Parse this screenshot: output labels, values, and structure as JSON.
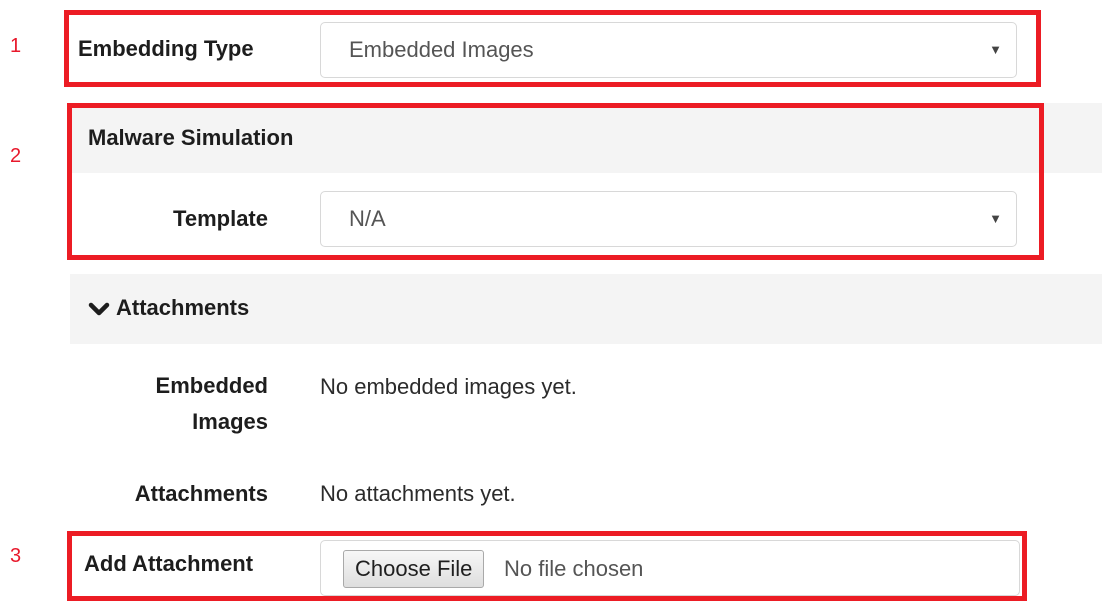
{
  "markers": [
    "1",
    "2",
    "3"
  ],
  "embedding": {
    "label": "Embedding Type",
    "selected": "Embedded Images"
  },
  "malware": {
    "title": "Malware Simulation",
    "template_label": "Template",
    "template_selected": "N/A"
  },
  "attachments": {
    "section_title": "Attachments",
    "embedded_label_line1": "Embedded",
    "embedded_label_line2": "Images",
    "embedded_value": "No embedded images yet.",
    "attachments_label": "Attachments",
    "attachments_value": "No attachments yet.",
    "add_label": "Add Attachment",
    "choose_button": "Choose File",
    "file_status": "No file chosen"
  },
  "colors": {
    "highlight": "#ec1c24",
    "marker": "#e8192c",
    "panel": "#f4f4f4"
  }
}
